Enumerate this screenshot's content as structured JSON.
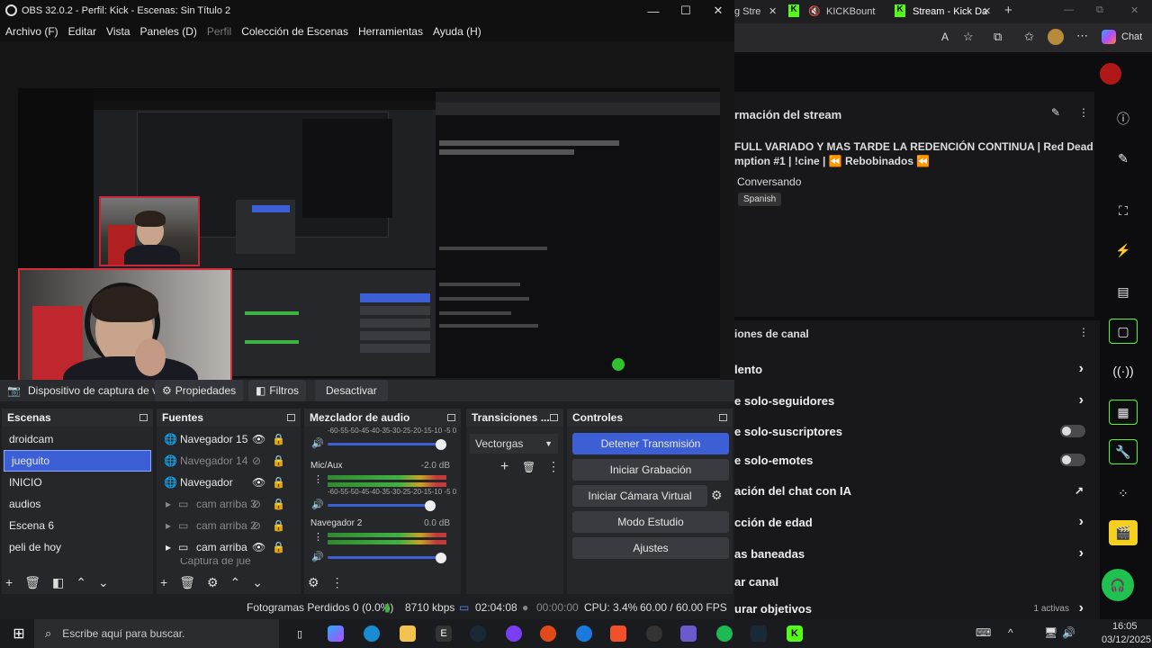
{
  "obs": {
    "title": "OBS 32.0.2 - Perfil: Kick - Escenas: Sin Título 2",
    "menu": [
      "Archivo (F)",
      "Editar",
      "Vista",
      "Paneles (D)",
      "Perfil",
      "Colección de Escenas",
      "Herramientas",
      "Ayuda (H)"
    ],
    "source_toolbar": {
      "device": "Dispositivo de captura de v",
      "properties": "Propiedades",
      "filters": "Filtros",
      "deactivate": "Desactivar"
    },
    "scenes": {
      "title": "Escenas",
      "items": [
        "droidcam",
        "jueguito",
        "INICIO",
        "audios",
        "Escena 6",
        "peli de hoy"
      ],
      "selected": "jueguito"
    },
    "sources": {
      "title": "Fuentes",
      "items": [
        {
          "label": "Navegador 15",
          "visible": true,
          "group": false
        },
        {
          "label": "Navegador 14",
          "visible": false,
          "group": false
        },
        {
          "label": "Navegador",
          "visible": true,
          "group": false
        },
        {
          "label": "cam arriba 3",
          "visible": false,
          "group": true
        },
        {
          "label": "cam arriba 2",
          "visible": false,
          "group": true
        },
        {
          "label": "cam arriba",
          "visible": true,
          "group": true
        },
        {
          "label": "Captura de jue",
          "visible": false,
          "group": false
        }
      ]
    },
    "mixer": {
      "title": "Mezclador de audio",
      "scale": "-60-55-50-45-40-35-30-25-20-15-10 -5  0",
      "channels": [
        {
          "name": "Mic/Aux",
          "db": "-2.0 dB",
          "level": 0.82
        },
        {
          "name": "Navegador 2",
          "db": "0.0 dB",
          "level": 0.86
        }
      ]
    },
    "transitions": {
      "title": "Transiciones ...",
      "selected": "Vectorgas"
    },
    "controls": {
      "title": "Controles",
      "buttons": [
        "Detener Transmisión",
        "Iniciar Grabación",
        "Iniciar Cámara Virtual",
        "Modo Estudio",
        "Ajustes"
      ]
    },
    "status": {
      "dropped": "Fotogramas Perdidos 0 (0.0%)",
      "bitrate": "8710 kbps",
      "stream_time": "02:04:08",
      "rec_time": "00:00:00",
      "cpu": "CPU: 3.4%",
      "fps": "60.00 / 60.00 FPS"
    }
  },
  "edge": {
    "tabs": [
      "g Stre",
      "KICKBount",
      "Stream - Kick Da"
    ],
    "chat_button": "Chat",
    "stream_info": {
      "header": "rmación del stream",
      "title_line1": "FULL VARIADO Y MAS TARDE LA REDENCIÓN CONTINUA | Red Dead",
      "title_line2": "mption #1 | !cine | ⏪ Rebobinados ⏪",
      "category": "Conversando",
      "language": "Spanish"
    },
    "channel_options": {
      "header": "iones de canal",
      "rows": [
        {
          "label": "lento",
          "control": "chevron"
        },
        {
          "label": "e solo-seguidores",
          "control": "chevron"
        },
        {
          "label": "e solo-suscriptores",
          "control": "toggle"
        },
        {
          "label": "e solo-emotes",
          "control": "toggle"
        },
        {
          "label": "ación del chat con IA",
          "control": "external"
        },
        {
          "label": "cción de edad",
          "control": "chevron"
        },
        {
          "label": "as baneadas",
          "control": "chevron"
        },
        {
          "label": "ar canal",
          "control": "none"
        },
        {
          "label": "urar objetivos",
          "control": "chevron"
        }
      ],
      "active_badge": "1 activas"
    }
  },
  "taskbar": {
    "search_placeholder": "Escribe aquí para buscar.",
    "time": "16:05",
    "date": "03/12/2025"
  }
}
